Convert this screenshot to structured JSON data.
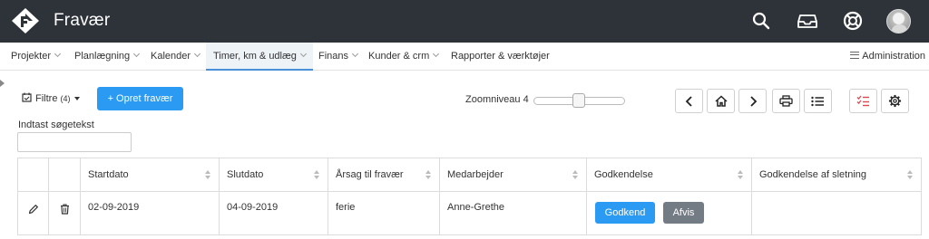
{
  "app": {
    "title": "Fravær"
  },
  "header": {
    "icons": [
      "search-icon",
      "inbox-icon",
      "help-lifebuoy-icon",
      "user-avatar"
    ]
  },
  "nav": {
    "items": [
      {
        "label": "Projekter",
        "has_dropdown": true
      },
      {
        "label": "Planlægning",
        "has_dropdown": true
      },
      {
        "label": "Kalender",
        "has_dropdown": true
      },
      {
        "label": "Timer, km & udlæg",
        "has_dropdown": true,
        "active": true
      },
      {
        "label": "Finans",
        "has_dropdown": true
      },
      {
        "label": "Kunder & crm",
        "has_dropdown": true
      },
      {
        "label": "Rapporter & værktøjer",
        "has_dropdown": false
      }
    ],
    "admin_label": "Administration"
  },
  "toolbar": {
    "filter_label": "Filtre",
    "filter_count": "(4)",
    "create_label": "+ Opret fravær",
    "zoom_label": "Zoomniveau 4",
    "zoom_level": 4,
    "icons": [
      "chevron-left-icon",
      "home-icon",
      "chevron-right-icon",
      "print-icon",
      "list-icon",
      "checklist-icon",
      "settings-gear-icon"
    ]
  },
  "search": {
    "label": "Indtast søgetekst",
    "value": "",
    "placeholder": ""
  },
  "table": {
    "columns": [
      "Startdato",
      "Slutdato",
      "Årsag til fravær",
      "Medarbejder",
      "Godkendelse",
      "Godkendelse af sletning"
    ],
    "rows": [
      {
        "startdato": "02-09-2019",
        "slutdato": "04-09-2019",
        "aarsag": "ferie",
        "medarbejder": "Anne-Grethe",
        "approve_label": "Godkend",
        "reject_label": "Afvis"
      }
    ]
  },
  "colors": {
    "topbar": "#2e3339",
    "primary": "#2b9af3",
    "reject": "#737c85",
    "checklist_icon": "#e0474c"
  }
}
